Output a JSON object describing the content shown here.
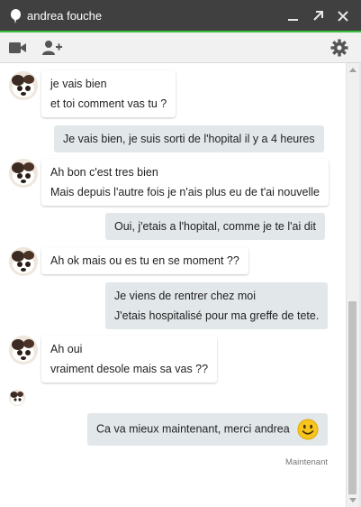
{
  "window": {
    "title": "andrea fouche",
    "accent_color": "#3bbf3b",
    "titlebar_color": "#404040"
  },
  "titlebar_buttons": [
    {
      "name": "minimize-icon"
    },
    {
      "name": "popout-icon"
    },
    {
      "name": "close-icon"
    }
  ],
  "toolbar": {
    "video_icon": "video-camera-icon",
    "add_person_icon": "add-person-icon",
    "settings_icon": "gear-icon"
  },
  "messages": [
    {
      "sender": "andrea",
      "lines": [
        "je vais bien",
        "et toi comment vas tu ?"
      ]
    },
    {
      "sender": "me",
      "lines": [
        "Je vais bien, je suis sorti de l'hopital il y a 4 heures"
      ]
    },
    {
      "sender": "andrea",
      "lines": [
        "Ah bon c'est tres bien",
        "Mais depuis l'autre fois je n'ais plus eu de t'ai nouvelle"
      ]
    },
    {
      "sender": "me",
      "lines": [
        "Oui, j'etais a l'hopital, comme je te l'ai dit"
      ]
    },
    {
      "sender": "andrea",
      "lines": [
        "Ah ok mais ou es tu en se moment ??"
      ]
    },
    {
      "sender": "me",
      "lines": [
        "Je viens de rentrer chez moi",
        "J'etais hospitalisé pour ma greffe de tete."
      ]
    },
    {
      "sender": "andrea",
      "lines": [
        "Ah oui",
        "vraiment desole mais sa vas ??"
      ]
    },
    {
      "sender": "me",
      "lines": [
        "Ca va mieux maintenant, merci andrea"
      ],
      "emoji": "smiley-icon"
    }
  ],
  "timestamp": "Maintenant"
}
